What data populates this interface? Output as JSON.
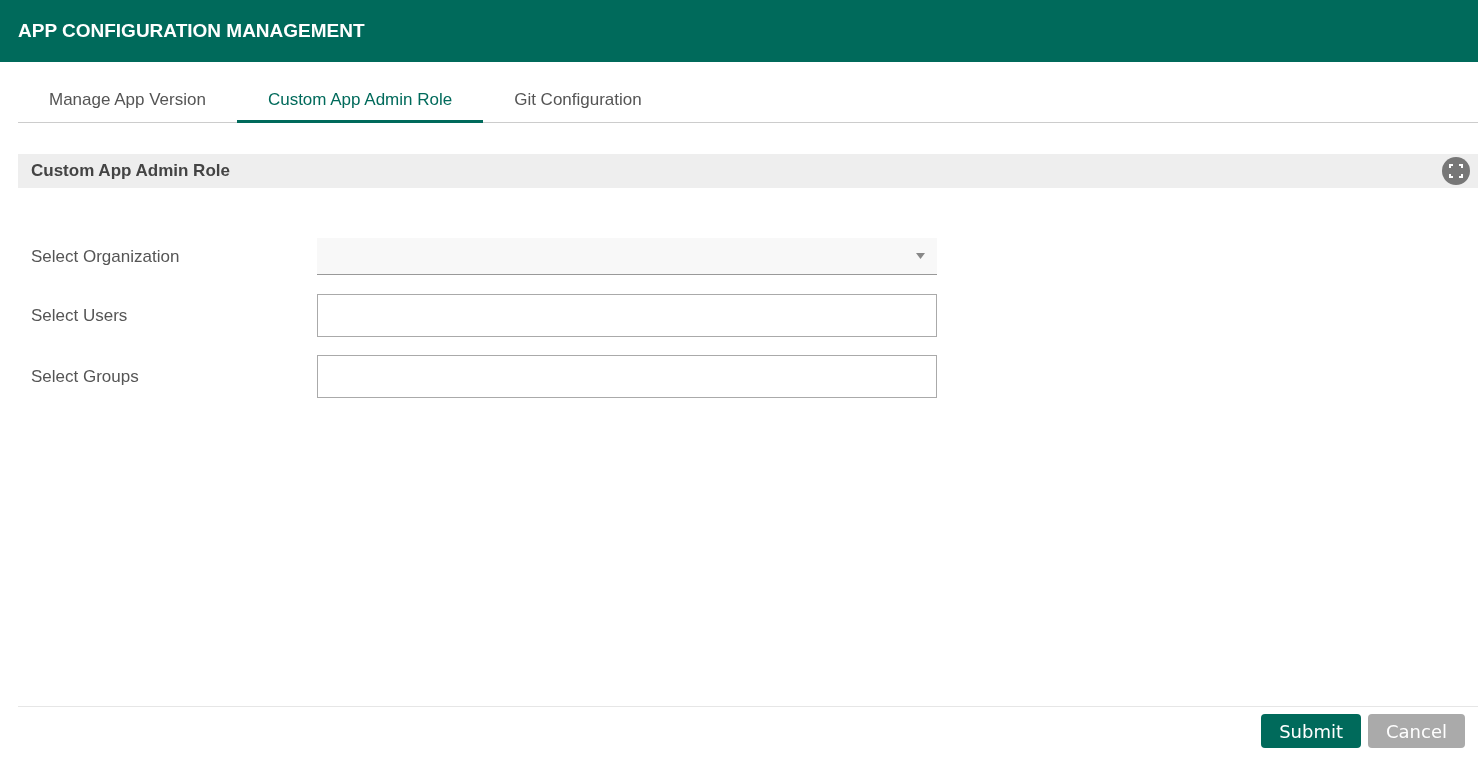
{
  "header": {
    "title": "APP CONFIGURATION MANAGEMENT"
  },
  "tabs": [
    {
      "label": "Manage App Version",
      "selected": false
    },
    {
      "label": "Custom App Admin Role",
      "selected": true
    },
    {
      "label": "Git Configuration",
      "selected": false
    }
  ],
  "panel": {
    "title": "Custom App Admin Role"
  },
  "fields": [
    {
      "label": "Select Organization",
      "kind": "select"
    },
    {
      "label": "Select Users",
      "kind": "text"
    },
    {
      "label": "Select Groups",
      "kind": "text"
    }
  ],
  "buttons": [
    {
      "label": "Submit",
      "kind": "primary"
    },
    {
      "label": "Cancel",
      "kind": "secondary"
    }
  ]
}
